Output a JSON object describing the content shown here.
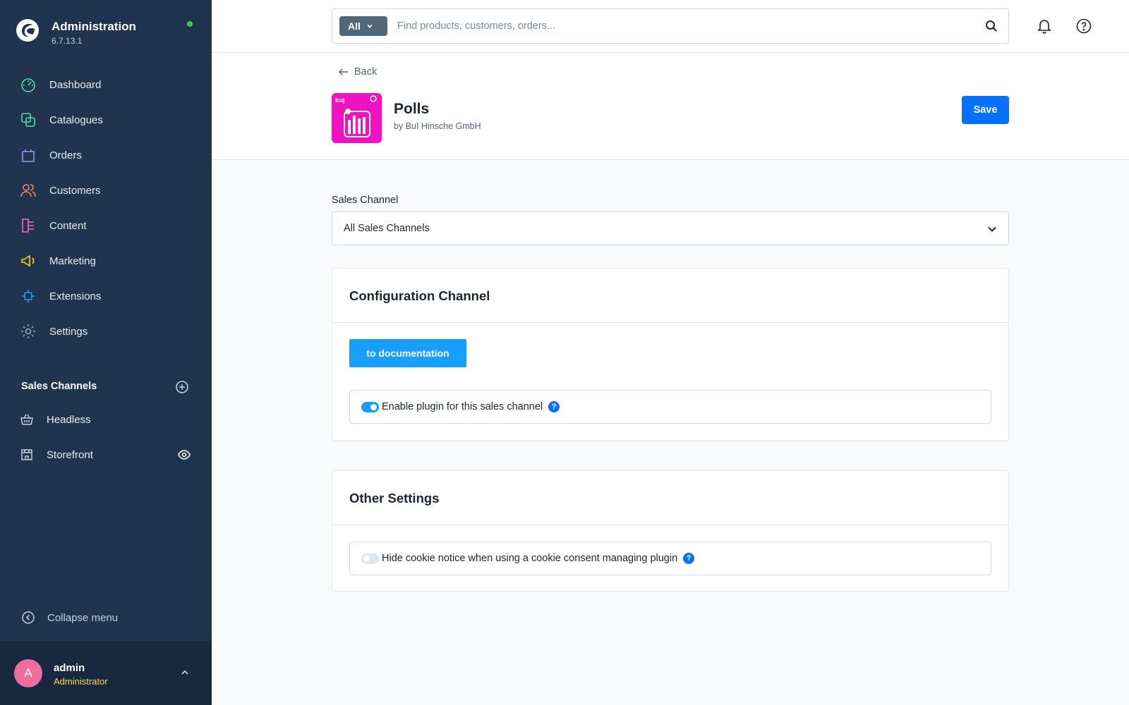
{
  "app": {
    "title": "Administration",
    "version": "6.7.13.1"
  },
  "nav": {
    "items": [
      {
        "label": "Dashboard",
        "icon": "dashboard-icon",
        "color": "#57d9a3"
      },
      {
        "label": "Catalogues",
        "icon": "catalogue-icon",
        "color": "#57d9a3"
      },
      {
        "label": "Orders",
        "icon": "orders-icon",
        "color": "#a092f0"
      },
      {
        "label": "Customers",
        "icon": "customers-icon",
        "color": "#f88962"
      },
      {
        "label": "Content",
        "icon": "content-icon",
        "color": "#ff68b4"
      },
      {
        "label": "Marketing",
        "icon": "marketing-icon",
        "color": "#ffd700"
      },
      {
        "label": "Extensions",
        "icon": "extensions-icon",
        "color": "#189eff"
      },
      {
        "label": "Settings",
        "icon": "settings-icon",
        "color": "#9aa8b5"
      }
    ]
  },
  "sales_channels": {
    "title": "Sales Channels",
    "items": [
      {
        "label": "Headless",
        "icon": "basket-icon"
      },
      {
        "label": "Storefront",
        "icon": "storefront-icon"
      }
    ]
  },
  "sidebar": {
    "collapse_label": "Collapse menu"
  },
  "user": {
    "initial": "A",
    "name": "admin",
    "role": "Administrator"
  },
  "search": {
    "type_label": "All",
    "placeholder": "Find products, customers, orders..."
  },
  "header": {
    "back_label": "Back",
    "plugin_name": "Polls",
    "plugin_vendor": "by BuI Hinsche GmbH",
    "save_label": "Save"
  },
  "plugin_icon_text": {
    "brand": "buj"
  },
  "form": {
    "sales_channel_label": "Sales Channel",
    "sales_channel_value": "All Sales Channels"
  },
  "config_card": {
    "title": "Configuration Channel",
    "doc_button": "to documentation",
    "toggle_label": "Enable plugin for this sales channel",
    "toggle_on": true
  },
  "other_card": {
    "title": "Other Settings",
    "toggle_label": "Hide cookie notice when using a cookie consent managing plugin",
    "toggle_on": false
  },
  "colors": {
    "sidebar_bg": "#20334f",
    "accent": "#0870ff",
    "doc_button": "#189eff",
    "plugin_icon_bg": "#f012c0",
    "status_dot": "#37d046"
  }
}
